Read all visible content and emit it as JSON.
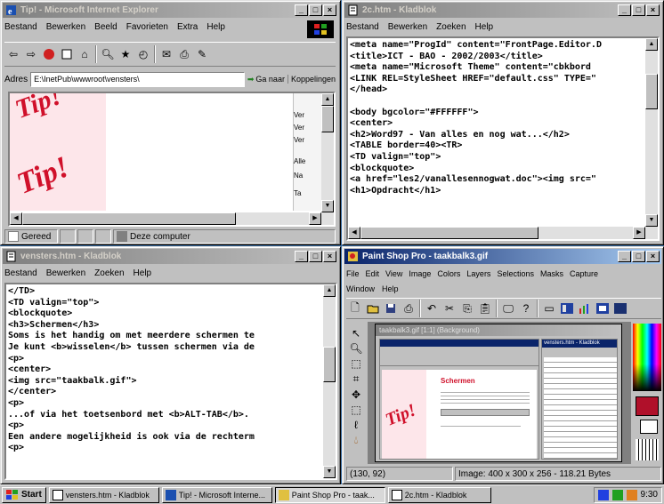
{
  "ie": {
    "title": "Tip! - Microsoft Internet Explorer",
    "menus": [
      "Bestand",
      "Bewerken",
      "Beeld",
      "Favorieten",
      "Extra",
      "Help"
    ],
    "address_label": "Adres",
    "address_value": "E:\\InetPub\\wwwroot\\vensters\\",
    "go_label": "Ga naar",
    "links_label": "Koppelingen",
    "side_items": [
      "Ver",
      "Ver",
      "Ver",
      "Alle",
      "Na",
      "Ta"
    ],
    "tip_text": "Tip!",
    "status_done": "Gereed",
    "status_zone": "Deze computer"
  },
  "notepad_top": {
    "title": "2c.htm - Kladblok",
    "menus": [
      "Bestand",
      "Bewerken",
      "Zoeken",
      "Help"
    ],
    "lines": [
      "<meta name=\"ProgId\" content=\"FrontPage.Editor.D",
      "<title>ICT - BAO - 2002/2003</title>",
      "<meta name=\"Microsoft Theme\" content=\"cbkbord",
      "<LINK REL=StyleSheet HREF=\"default.css\" TYPE=\"",
      "</head>",
      "",
      "<body bgcolor=\"#FFFFFF\">",
      "<center>",
      "<h2>Word97 - Van alles en nog wat...</h2>",
      "<TABLE border=40><TR>",
      "<TD valign=\"top\">",
      "<blockquote>",
      "<a href=\"les2/vanallesennogwat.doc\"><img src=\"",
      "<h1>Opdracht</h1>"
    ]
  },
  "notepad_bottom": {
    "title": "vensters.htm - Kladblok",
    "menus": [
      "Bestand",
      "Bewerken",
      "Zoeken",
      "Help"
    ],
    "lines": [
      "</TD>",
      "<TD valign=\"top\">",
      "<blockquote>",
      "<h3>Schermen</h3>",
      "Soms is het handig om met meerdere schermen te",
      "Je kunt <b>wisselen</b> tussen schermen via de",
      "<p>",
      "<center>",
      "<img src=\"taakbalk.gif\">",
      "</center>",
      "<p>",
      "...of via het toetsenbord met <b>ALT-TAB</b>.",
      "<p>",
      "Een andere mogelijkheid is ook via de rechterm",
      "<p>"
    ]
  },
  "psp": {
    "title": "Paint Shop Pro - taakbalk3.gif",
    "menus_row1": [
      "File",
      "Edit",
      "View",
      "Image",
      "Colors",
      "Layers",
      "Selections",
      "Masks",
      "Capture"
    ],
    "menus_row2": [
      "Window",
      "Help"
    ],
    "doc_title": "taakbalk3.gif [1:1] (Background)",
    "inner_heading": "Schermen",
    "inner_tip": "Tip!",
    "inner_np_title": "vensters.htm - Kladblok",
    "status_coords": "(130, 92)",
    "status_image": "Image: 400 x 300 x 256 - 118.21 Bytes",
    "fg_color": "#b0102a"
  },
  "taskbar": {
    "start": "Start",
    "tasks": [
      "vensters.htm - Kladblok",
      "Tip! - Microsoft Interne...",
      "Paint Shop Pro - taak...",
      "2c.htm - Kladblok"
    ],
    "clock": "9:30"
  },
  "colors": {
    "desktop": "#3a6ea5",
    "titlebar_active": "#0a246a",
    "tip_red": "#d0102a"
  }
}
